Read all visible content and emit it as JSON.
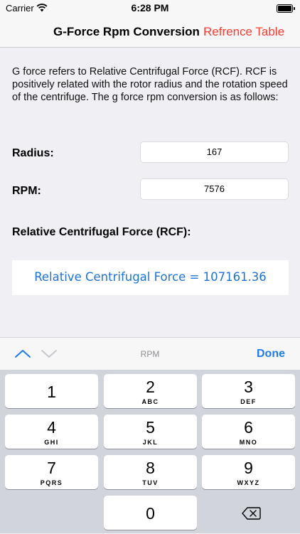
{
  "status_bar": {
    "carrier": "Carrier",
    "time": "6:28 PM"
  },
  "nav": {
    "title": "G-Force Rpm Conversion",
    "right_link": "Refrence Table"
  },
  "intro": "G force refers to Relative Centrifugal Force (RCF). RCF is positively related with the rotor radius and the rotation speed of the centrifuge. The g force rpm conversion is as follows:",
  "form": {
    "radius_label": "Radius:",
    "radius_value": "167",
    "rpm_label": "RPM:",
    "rpm_value": "7576",
    "rcf_label": "Relative Centrifugal Force (RCF):"
  },
  "result": "Relative Centrifugal Force = 107161.36",
  "keyboard": {
    "field_name": "RPM",
    "done_label": "Done",
    "keys": [
      {
        "num": "1",
        "letters": ""
      },
      {
        "num": "2",
        "letters": "ABC"
      },
      {
        "num": "3",
        "letters": "DEF"
      },
      {
        "num": "4",
        "letters": "GHI"
      },
      {
        "num": "5",
        "letters": "JKL"
      },
      {
        "num": "6",
        "letters": "MNO"
      },
      {
        "num": "7",
        "letters": "PQRS"
      },
      {
        "num": "8",
        "letters": "TUV"
      },
      {
        "num": "9",
        "letters": "WXYZ"
      },
      {
        "num": "0",
        "letters": ""
      }
    ]
  },
  "colors": {
    "accent_red": "#ff3b30",
    "result_blue": "#1e72d6",
    "done_blue": "#1f7bf0"
  },
  "icons": [
    "wifi-icon",
    "battery-icon",
    "chevron-up-icon",
    "chevron-down-icon",
    "backspace-icon"
  ]
}
